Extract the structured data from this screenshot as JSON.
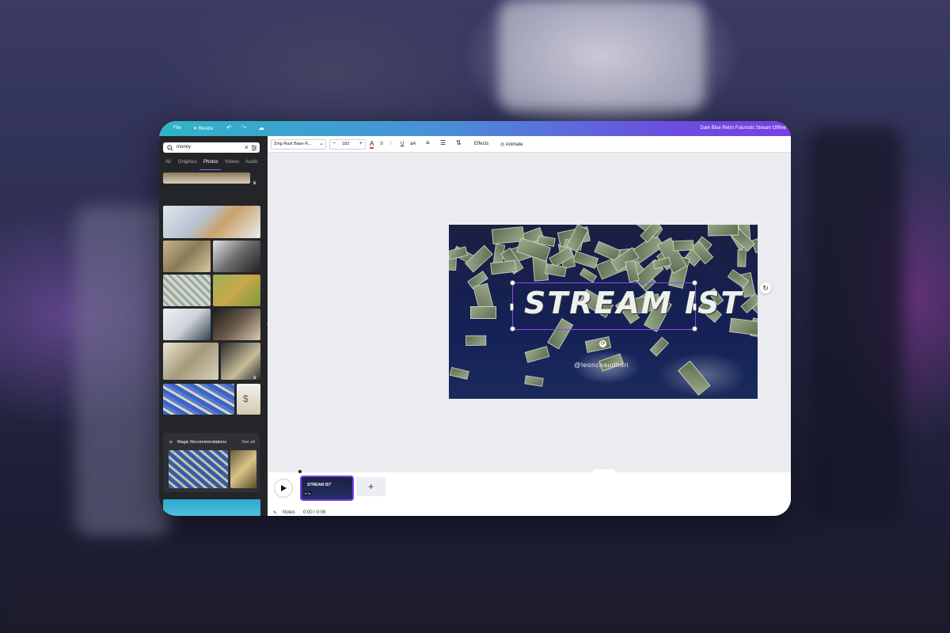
{
  "topbar": {
    "file_label": "File",
    "resize_label": "Resize",
    "doc_title": "Dark Blue Retro Futuristic Stream Offline"
  },
  "sidebar": {
    "search": {
      "value": "money"
    },
    "tabs": [
      "All",
      "Graphics",
      "Photos",
      "Videos",
      "Audio"
    ],
    "active_tab": "Photos",
    "magic": {
      "label": "Magic Recommendations",
      "see_all": "See all"
    }
  },
  "toolbar": {
    "font_name": "Zing Rust Base R...",
    "font_size": "182",
    "effects_label": "Effects",
    "animate_label": "Animate"
  },
  "design": {
    "headline": "STREAM IST",
    "handle": "@leonchaudhari"
  },
  "timeline": {
    "clip_label": "STREAM IST",
    "clip_duration": "6.0s",
    "add_label": "+",
    "notes_label": "Notes",
    "time": "0:00 / 0:06"
  },
  "colors": {
    "accent": "#7a3fe3",
    "topbar_start": "#2fb5c8",
    "topbar_end": "#7a3fe3",
    "sidebar_bg": "#242529"
  }
}
